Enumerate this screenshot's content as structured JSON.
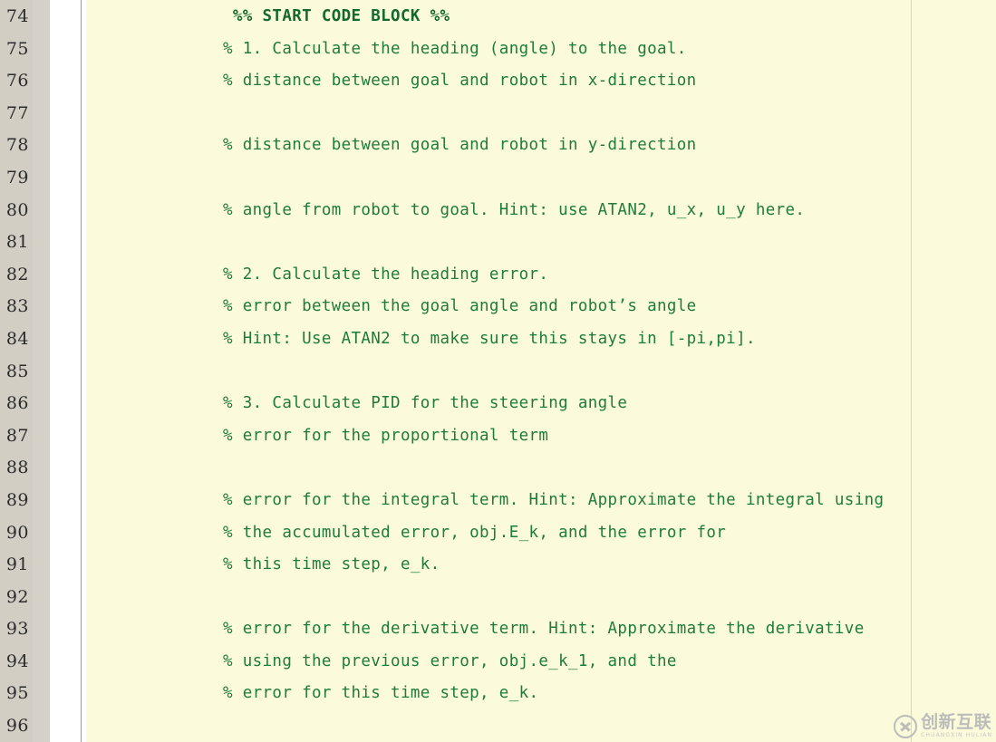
{
  "editor": {
    "language": "MATLAB",
    "colors": {
      "code_background": "#fbfbdb",
      "comment_text": "#1f7a3d",
      "gutter_background": "#d2cec4",
      "gutter_text": "#2c2c2c",
      "column_ruler": "#d8d8c2",
      "fold_divider": "#9a9a96"
    },
    "first_line_number": 74,
    "last_line_number": 96,
    "lines": [
      {
        "number": 74,
        "text": " %% START CODE BLOCK %%",
        "bold": true
      },
      {
        "number": 75,
        "text": "% 1. Calculate the heading (angle) to the goal.",
        "bold": false
      },
      {
        "number": 76,
        "text": "% distance between goal and robot in x-direction",
        "bold": false
      },
      {
        "number": 77,
        "text": "",
        "bold": false
      },
      {
        "number": 78,
        "text": "% distance between goal and robot in y-direction",
        "bold": false
      },
      {
        "number": 79,
        "text": "",
        "bold": false
      },
      {
        "number": 80,
        "text": "% angle from robot to goal. Hint: use ATAN2, u_x, u_y here.",
        "bold": false
      },
      {
        "number": 81,
        "text": "",
        "bold": false
      },
      {
        "number": 82,
        "text": "% 2. Calculate the heading error.",
        "bold": false
      },
      {
        "number": 83,
        "text": "% error between the goal angle and robot’s angle",
        "bold": false
      },
      {
        "number": 84,
        "text": "% Hint: Use ATAN2 to make sure this stays in [-pi,pi].",
        "bold": false
      },
      {
        "number": 85,
        "text": "",
        "bold": false
      },
      {
        "number": 86,
        "text": "% 3. Calculate PID for the steering angle",
        "bold": false
      },
      {
        "number": 87,
        "text": "% error for the proportional term",
        "bold": false
      },
      {
        "number": 88,
        "text": "",
        "bold": false
      },
      {
        "number": 89,
        "text": "% error for the integral term. Hint: Approximate the integral using",
        "bold": false
      },
      {
        "number": 90,
        "text": "% the accumulated error, obj.E_k, and the error for",
        "bold": false
      },
      {
        "number": 91,
        "text": "% this time step, e_k.",
        "bold": false
      },
      {
        "number": 92,
        "text": "",
        "bold": false
      },
      {
        "number": 93,
        "text": "% error for the derivative term. Hint: Approximate the derivative",
        "bold": false
      },
      {
        "number": 94,
        "text": "% using the previous error, obj.e_k_1, and the",
        "bold": false
      },
      {
        "number": 95,
        "text": "% error for this time step, e_k.",
        "bold": false
      },
      {
        "number": 96,
        "text": "",
        "bold": false
      }
    ]
  },
  "watermark": {
    "logo_icon": "circled-x-icon",
    "chinese_text": "创新互联",
    "english_text": "CHUANGXIN HULIAN"
  }
}
